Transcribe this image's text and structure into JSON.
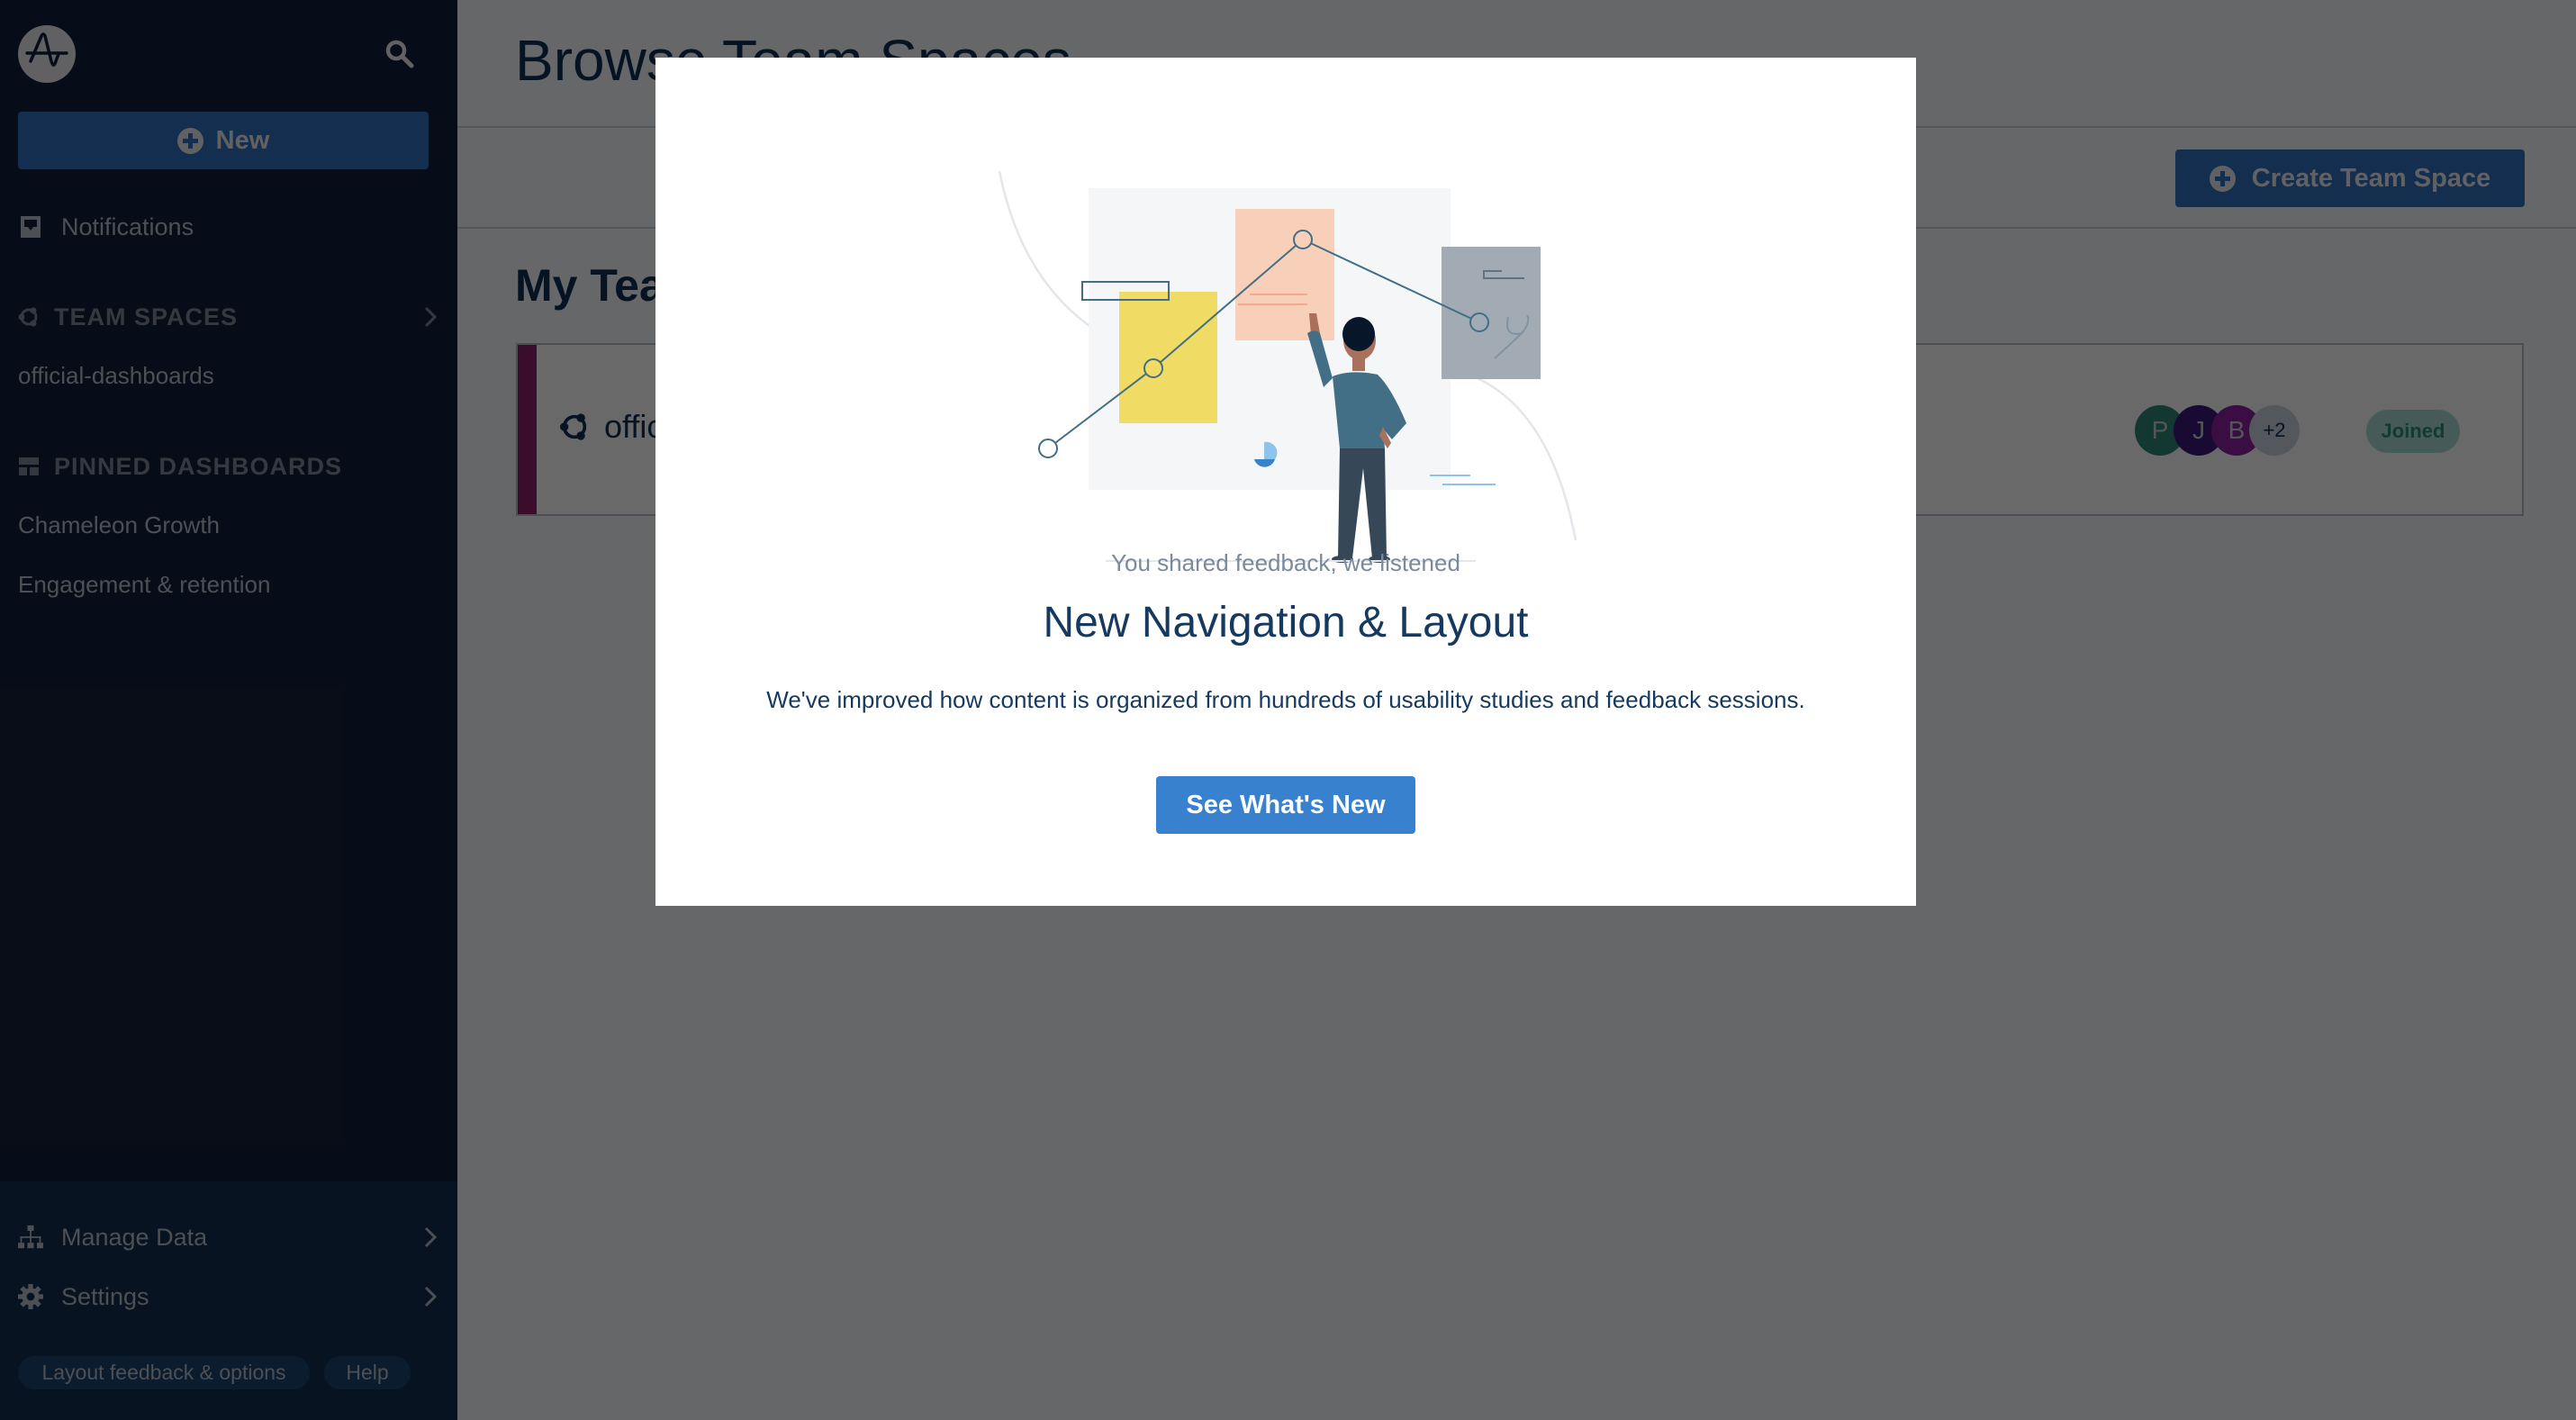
{
  "sidebar": {
    "new_button_label": "New",
    "notifications_label": "Notifications",
    "team_spaces_header": "TEAM SPACES",
    "team_spaces": [
      "official-dashboards"
    ],
    "pinned_header": "PINNED DASHBOARDS",
    "pinned_dashboards": [
      "Chameleon Growth",
      "Engagement & retention"
    ],
    "manage_data_label": "Manage Data",
    "settings_label": "Settings",
    "feedback_pill_label": "Layout feedback & options",
    "help_pill_label": "Help",
    "icons": {
      "logo": "amplitude-logo",
      "search": "search-icon",
      "notifications": "inbox-icon",
      "team_spaces": "team-space-icon",
      "pinned": "dashboard-icon",
      "manage_data": "hierarchy-icon",
      "settings": "gear-icon"
    }
  },
  "main": {
    "page_title": "Browse Team Spaces",
    "create_button_label": "Create Team Space",
    "section_title": "My Team Spaces",
    "team_card": {
      "name": "official-dashboards",
      "stripe_color": "#8b1f6c",
      "members": [
        {
          "initial": "P",
          "color": "#2e8576"
        },
        {
          "initial": "J",
          "color": "#3a1a7a"
        },
        {
          "initial": "B",
          "color": "#8a1fa0"
        }
      ],
      "more_members": "+2",
      "status": "Joined"
    }
  },
  "modal": {
    "eyebrow": "You shared feedback, we listened",
    "title": "New Navigation & Layout",
    "body": "We've improved how content is organized from hundreds of usability studies and feedback sessions.",
    "cta_label": "See What's New",
    "cta_color": "#3781cf"
  },
  "colors": {
    "sidebar_bg": "#12203a",
    "primary_button": "#2f6fb9",
    "heading_text": "#0f2f52"
  }
}
